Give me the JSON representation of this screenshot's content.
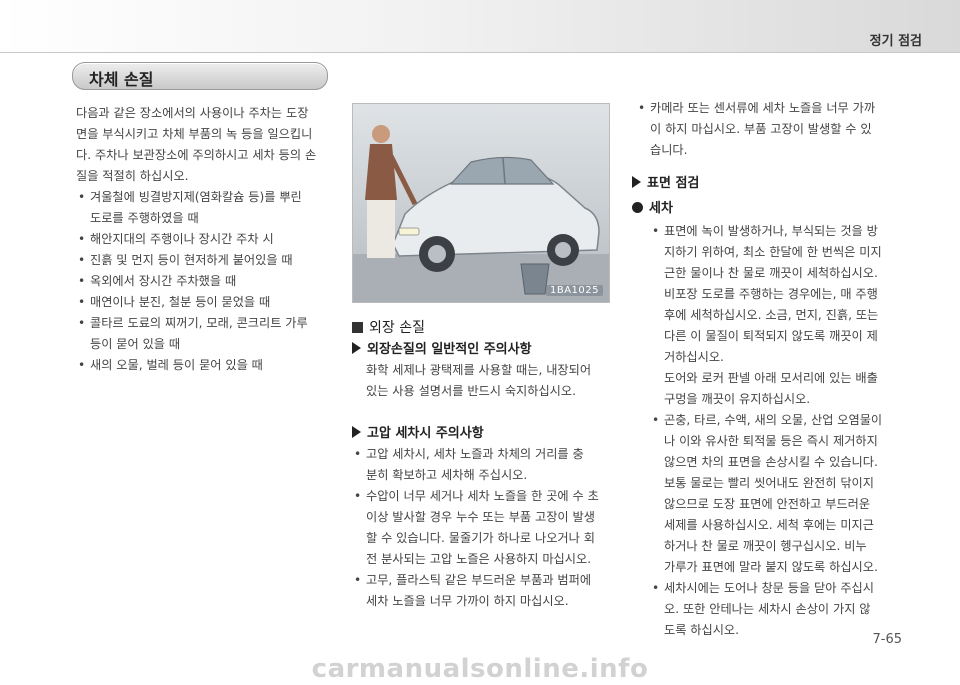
{
  "header": {
    "chapter": "정기 점검"
  },
  "section": {
    "title": "차체 손질"
  },
  "left": {
    "intro": [
      "다음과 같은 장소에서의 사용이나 주차는 도장",
      "면을 부식시키고 차체 부품의 녹 등을 일으킵니",
      "다.  주차나 보관장소에 주의하시고 세차 등의 손",
      "질을 적절히 하십시오."
    ],
    "items": [
      [
        "겨울철에 빙결방지제(염화칼슘 등)를 뿌린",
        "도로를 주행하였을 때"
      ],
      [
        "해안지대의 주행이나 장시간 주차 시"
      ],
      [
        "진흙 및 먼지 등이 현저하게 붙어있을 때"
      ],
      [
        "옥외에서 장시간 주차했을 때"
      ],
      [
        "매연이나 분진, 철분 등이 묻었을 때"
      ],
      [
        "콜타르 도료의 찌꺼기, 모래, 콘크리트 가루",
        "등이 묻어 있을 때"
      ],
      [
        "새의 오물, 벌레 등이 묻어 있을 때"
      ]
    ]
  },
  "figure": {
    "code": "1BA1025"
  },
  "middle": {
    "h1": "외장 손질",
    "sub1": {
      "title": "외장손질의 일반적인 주의사항",
      "lines": [
        "화학 세제나 광택제를 사용할 때는, 내장되어",
        "있는 사용 설명서를 반드시 숙지하십시오."
      ]
    },
    "sub2": {
      "title": "고압 세차시 주의사항",
      "items": [
        [
          "고압 세차시, 세차 노즐과 차체의 거리를 충",
          "분히 확보하고 세차해 주십시오."
        ],
        [
          "수압이 너무 세거나 세차 노즐을 한 곳에 수 초",
          "이상 발사할 경우 누수 또는 부품 고장이 발생",
          "할 수 있습니다. 물줄기가 하나로 나오거나 회",
          "전 분사되는 고압 노즐은 사용하지 마십시오."
        ],
        [
          "고무, 플라스틱 같은 부드러운 부품과 범퍼에",
          "세차 노즐을 너무 가까이 하지 마십시오."
        ]
      ]
    }
  },
  "right": {
    "item0": [
      "카메라 또는 센서류에 세차 노즐을 너무 가까",
      "이 하지 마십시오. 부품 고장이 발생할 수 있",
      "습니다."
    ],
    "h2": "표면 점검",
    "h3": "세차",
    "items": [
      [
        "표면에 녹이 발생하거나, 부식되는 것을 방",
        "지하기 위하여, 최소 한달에 한 번씩은 미지",
        "근한 물이나 찬 물로 깨끗이 세척하십시오.",
        "비포장 도로를 주행하는 경우에는, 매 주행",
        "후에 세척하십시오. 소금, 먼지, 진흙, 또는",
        "다른 이 물질이 퇴적되지 않도록 깨끗이 제",
        "거하십시오.",
        "도어와 로커 판넬 아래 모서리에 있는 배출",
        "구멍을 깨끗이 유지하십시오."
      ],
      [
        "곤충, 타르, 수액, 새의 오물, 산업 오염물이",
        "나 이와 유사한 퇴적물 등은 즉시 제거하지",
        "않으면 차의 표면을 손상시킬 수 있습니다.",
        "보통 물로는 빨리 씻어내도 완전히 닦이지",
        "않으므로 도장 표면에 안전하고 부드러운",
        "세제를 사용하십시오. 세척 후에는 미지근",
        "하거나 찬 물로 깨끗이 헹구십시오. 비누",
        "가루가 표면에 말라 붙지 않도록 하십시오."
      ],
      [
        "세차시에는 도어나 창문 등을 닫아 주십시",
        "오.  또한 안테나는 세차시 손상이 가지 않",
        "도록 하십시오."
      ]
    ]
  },
  "footer": {
    "page": "7-65",
    "watermark": "carmanualsonline.info"
  }
}
